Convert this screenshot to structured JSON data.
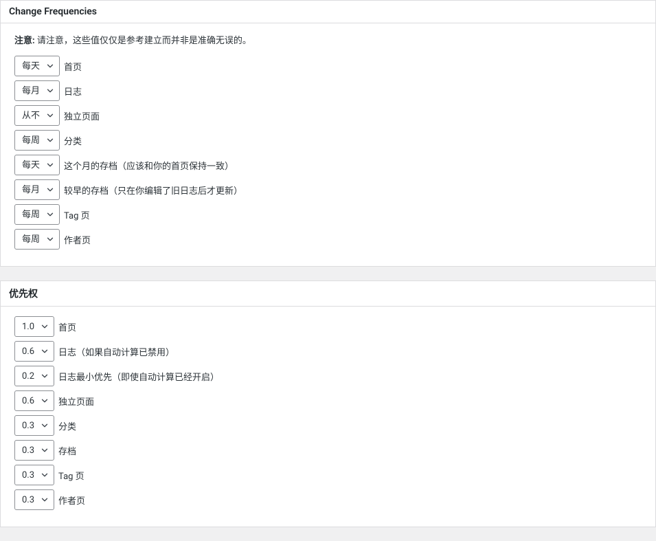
{
  "change_frequencies": {
    "title": "Change Frequencies",
    "notice_label": "注意:",
    "notice_text": " 请注意，这些值仅仅是参考建立而并非是准确无误的。",
    "rows": [
      {
        "value": "每天",
        "label": "首页"
      },
      {
        "value": "每月",
        "label": "日志"
      },
      {
        "value": "从不",
        "label": "独立页面"
      },
      {
        "value": "每周",
        "label": "分类"
      },
      {
        "value": "每天",
        "label": "这个月的存档（应该和你的首页保持一致）"
      },
      {
        "value": "每月",
        "label": "较早的存档（只在你编辑了旧日志后才更新）"
      },
      {
        "value": "每周",
        "label": "Tag 页"
      },
      {
        "value": "每周",
        "label": "作者页"
      }
    ]
  },
  "priorities": {
    "title": "优先权",
    "rows": [
      {
        "value": "1.0",
        "label": "首页"
      },
      {
        "value": "0.6",
        "label": "日志（如果自动计算已禁用）"
      },
      {
        "value": "0.2",
        "label": "日志最小优先（即使自动计算已经开启）"
      },
      {
        "value": "0.6",
        "label": "独立页面"
      },
      {
        "value": "0.3",
        "label": "分类"
      },
      {
        "value": "0.3",
        "label": "存档"
      },
      {
        "value": "0.3",
        "label": "Tag 页"
      },
      {
        "value": "0.3",
        "label": "作者页"
      }
    ]
  }
}
